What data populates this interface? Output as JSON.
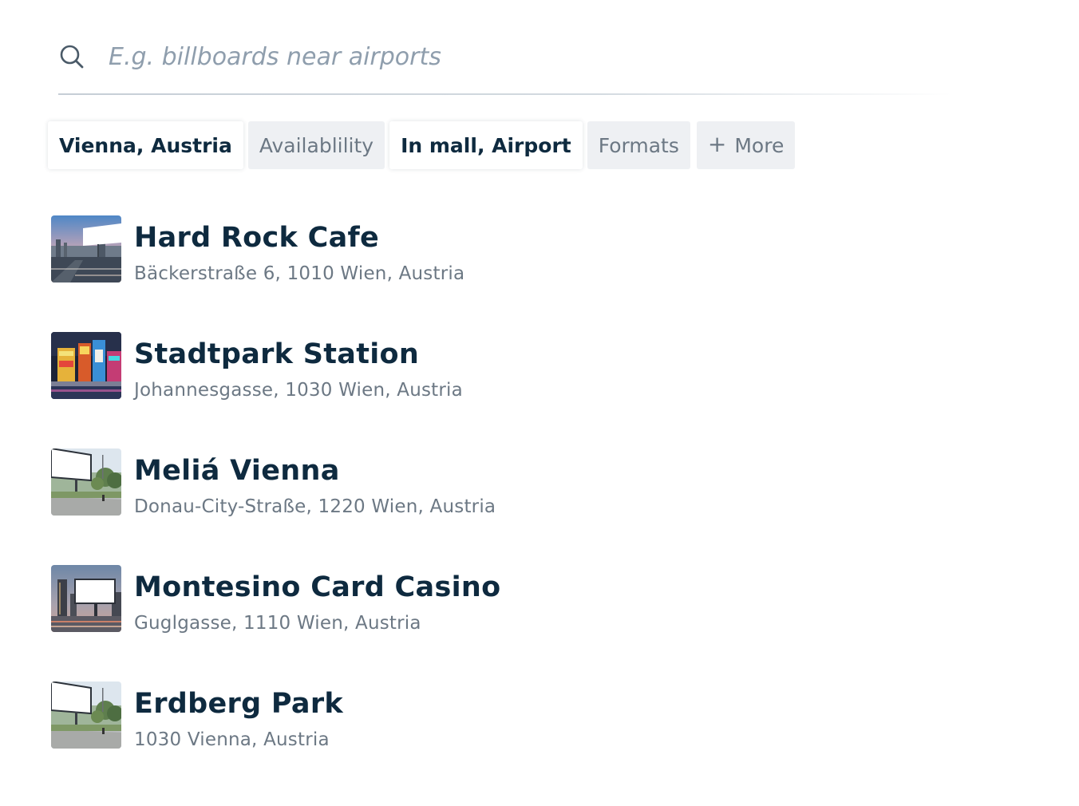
{
  "search": {
    "placeholder": "E.g. billboards near airports",
    "icon": "search-icon"
  },
  "filters": [
    {
      "label": "Vienna, Austria",
      "active": true
    },
    {
      "label": "Availablility",
      "active": false
    },
    {
      "label": "In mall, Airport",
      "active": true
    },
    {
      "label": "Formats",
      "active": false
    },
    {
      "label": "More",
      "active": false,
      "icon": "plus-icon",
      "icon_glyph": "+"
    }
  ],
  "results": [
    {
      "name": "Hard Rock Cafe",
      "address": "Bäckerstraße 6, 1010 Wien, Austria",
      "thumbnail": "city-highway-billboard-dusk"
    },
    {
      "name": "Stadtpark Station",
      "address": "Johannesgasse, 1030 Wien, Austria",
      "thumbnail": "neon-city-night"
    },
    {
      "name": "Meliá Vienna",
      "address": "Donau-City-Straße, 1220 Wien, Austria",
      "thumbnail": "roadside-billboard-trees"
    },
    {
      "name": "Montesino Card Casino",
      "address": "Guglgasse, 1110 Wien, Austria",
      "thumbnail": "billboard-city-dusk"
    },
    {
      "name": "Erdberg Park",
      "address": "1030 Vienna, Austria",
      "thumbnail": "roadside-billboard-trees"
    }
  ],
  "colors": {
    "text_primary": "#0e2a3f",
    "text_secondary": "#6c7884",
    "chip_inactive_bg": "#eef0f3",
    "placeholder": "#8f9ead"
  }
}
